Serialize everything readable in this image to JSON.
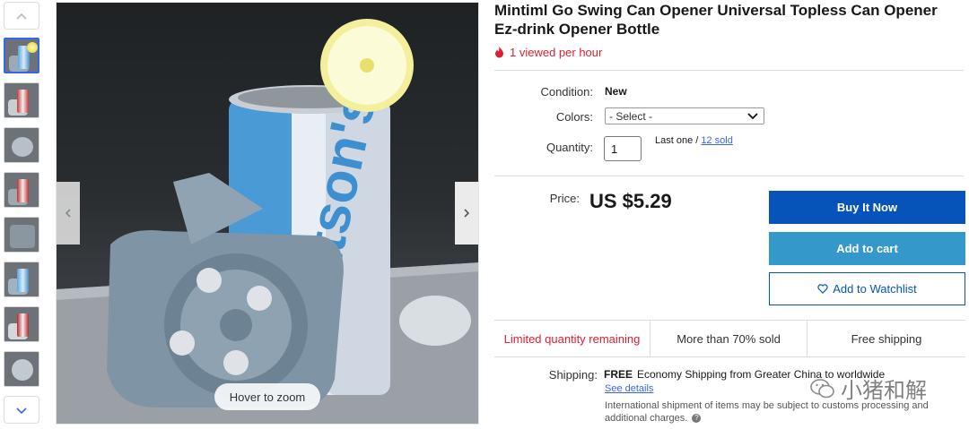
{
  "product": {
    "title": "Mintiml Go Swing Can Opener Universal Topless Can Opener Ez-drink Opener Bottle",
    "viewed_text": "1 viewed per hour"
  },
  "image": {
    "hover_zoom": "Hover to zoom",
    "thumbnail_count": 8,
    "active_thumbnail": 1
  },
  "details": {
    "condition_label": "Condition:",
    "condition_value": "New",
    "colors_label": "Colors:",
    "colors_selected": "- Select -",
    "quantity_label": "Quantity:",
    "quantity_value": "1",
    "quantity_note": "Last one / ",
    "sold_link": "12 sold"
  },
  "price": {
    "label": "Price:",
    "value": "US $5.29"
  },
  "actions": {
    "buy_now": "Buy It Now",
    "add_to_cart": "Add to cart",
    "watchlist": "Add to Watchlist"
  },
  "highlights": {
    "limited": "Limited quantity remaining",
    "sold_pct": "More than 70% sold",
    "free_shipping": "Free shipping"
  },
  "shipping": {
    "label": "Shipping:",
    "free": "FREE",
    "description": "Economy Shipping from Greater China to worldwide",
    "see_details": "See details",
    "international_note": "International shipment of items may be subject to customs processing and additional charges.",
    "help_glyph": "?"
  },
  "watermark": {
    "text": "小猪和解"
  },
  "colors": {
    "accent_blue": "#0654ba",
    "cart_blue": "#3498ca",
    "alert_red": "#dd1e31",
    "link_blue": "#3665f3"
  },
  "icons": {
    "thumb_up": "chevron-up-icon",
    "thumb_down": "chevron-down-icon",
    "image_prev": "chevron-left-icon",
    "image_next": "chevron-right-icon",
    "viewed": "flame-icon",
    "select": "chevron-down-icon",
    "watchlist": "heart-icon",
    "watermark": "wechat-icon"
  }
}
